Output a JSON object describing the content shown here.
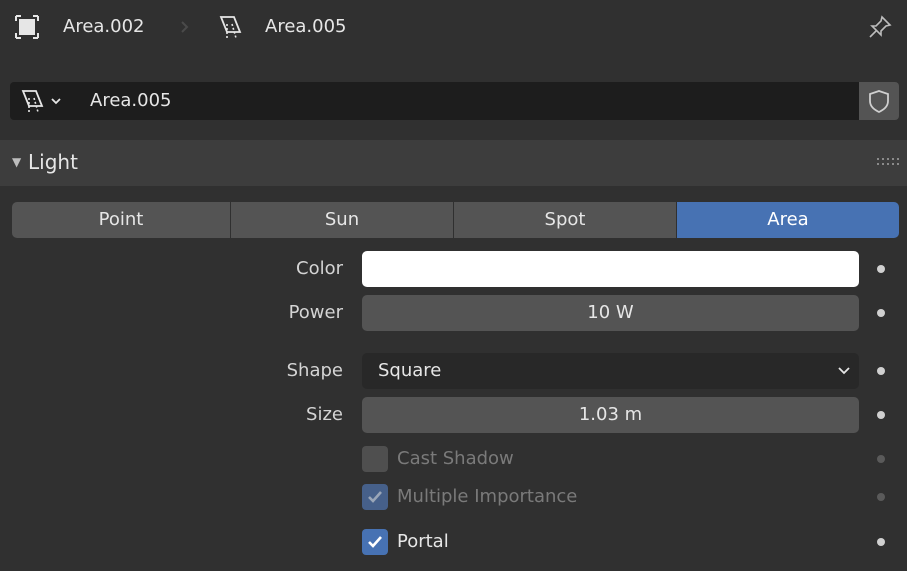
{
  "breadcrumb": {
    "object_name": "Area.002",
    "object_icon": "object-data-icon",
    "light_name": "Area.005",
    "light_icon": "area-light-icon"
  },
  "datablock": {
    "icon": "area-light-icon",
    "name": "Area.005",
    "fake_user_icon": "shield-icon"
  },
  "panel": {
    "title": "Light",
    "light_types": [
      "Point",
      "Sun",
      "Spot",
      "Area"
    ],
    "active_type": "Area"
  },
  "properties": {
    "color_label": "Color",
    "color_value": "#ffffff",
    "power_label": "Power",
    "power_value": "10 W",
    "shape_label": "Shape",
    "shape_value": "Square",
    "size_label": "Size",
    "size_value": "1.03 m"
  },
  "options": {
    "cast_shadow_label": "Cast Shadow",
    "cast_shadow_checked": false,
    "multiple_importance_label": "Multiple Importance",
    "multiple_importance_checked": true,
    "portal_label": "Portal",
    "portal_checked": true
  },
  "colors": {
    "accent": "#4772b3",
    "background": "#303030",
    "field": "#545454"
  }
}
